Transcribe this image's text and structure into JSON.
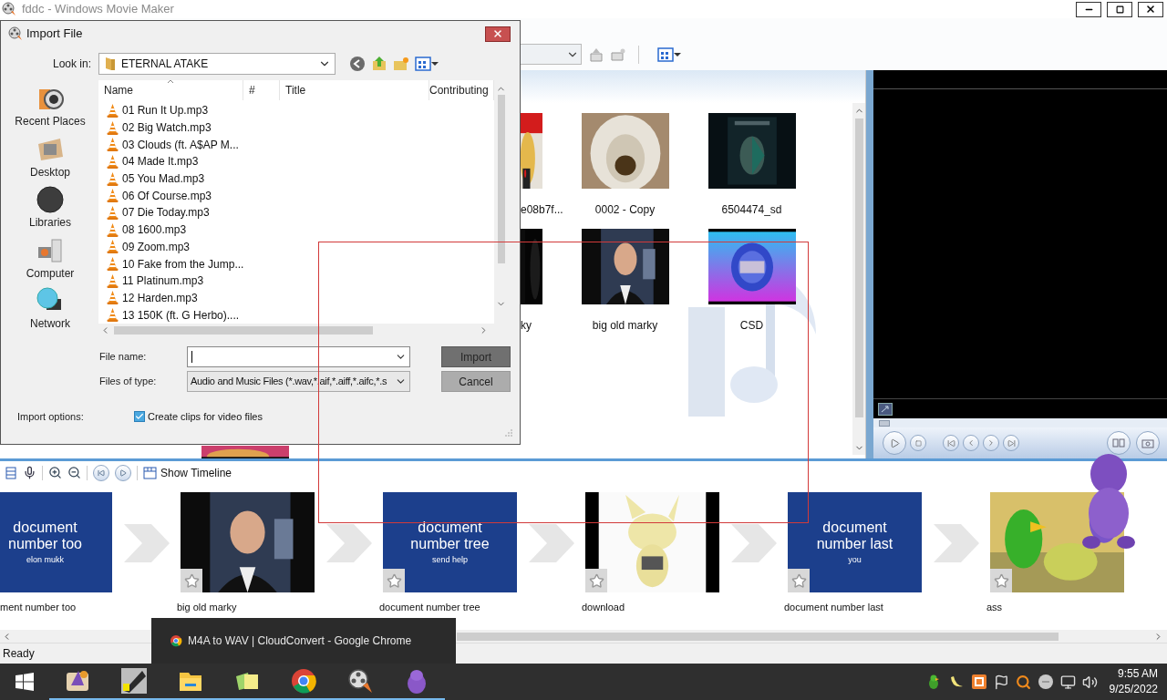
{
  "window": {
    "title": "fddc - Windows Movie Maker"
  },
  "collection": {
    "rows": [
      [
        {
          "label": "e08b7f..."
        },
        {
          "label": "0002 - Copy"
        },
        {
          "label": "6504474_sd"
        }
      ],
      [
        {
          "label": "ky"
        },
        {
          "label": "big old marky"
        },
        {
          "label": "CSD"
        }
      ]
    ]
  },
  "storyboard": {
    "show_timeline": "Show Timeline",
    "clips": [
      {
        "kind": "slide",
        "lines": [
          "document",
          "number too"
        ],
        "subtitle": "elon mukk",
        "label": "ment number too"
      },
      {
        "kind": "picture",
        "label": "big old marky"
      },
      {
        "kind": "slide",
        "lines": [
          "document",
          "number tree"
        ],
        "subtitle": "send help",
        "label": "document number tree"
      },
      {
        "kind": "picture",
        "label": "download"
      },
      {
        "kind": "slide",
        "lines": [
          "document",
          "number last"
        ],
        "subtitle": "you",
        "label": "document number last"
      },
      {
        "kind": "picture",
        "label": "ass"
      }
    ]
  },
  "status_bar": {
    "text": "Ready"
  },
  "taskbar_preview": {
    "title": "M4A to WAV | CloudConvert - Google Chrome"
  },
  "clock": {
    "time": "9:55 AM",
    "date": "9/25/2022"
  },
  "dialog": {
    "title": "Import File",
    "look_in_label": "Look in:",
    "look_in_value": "ETERNAL ATAKE",
    "places": [
      "Recent Places",
      "Desktop",
      "Libraries",
      "Computer",
      "Network"
    ],
    "columns": [
      "Name",
      "#",
      "Title",
      "Contributing"
    ],
    "files": [
      "01 Run It Up.mp3",
      "02 Big Watch.mp3",
      "03 Clouds (ft. A$AP M...",
      "04 Made It.mp3",
      "05 You Mad.mp3",
      "06 Of Course.mp3",
      "07 Die Today.mp3",
      "08 1600.mp3",
      "09 Zoom.mp3",
      "10 Fake from the Jump...",
      "11 Platinum.mp3",
      "12 Harden.mp3",
      "13 150K (ft. G Herbo)...."
    ],
    "file_name_label": "File name:",
    "file_type_label": "Files of type:",
    "file_type_value": "Audio and Music Files (*.wav,*.aif,*.aiff,*.aifc,*.s",
    "buttons": [
      {
        "label": "Import",
        "kind": "default"
      },
      {
        "label": "Cancel",
        "kind": "normal"
      }
    ],
    "import_options_label": "Import options:",
    "create_clips": {
      "label": "Create clips for video files",
      "checked": true
    }
  }
}
